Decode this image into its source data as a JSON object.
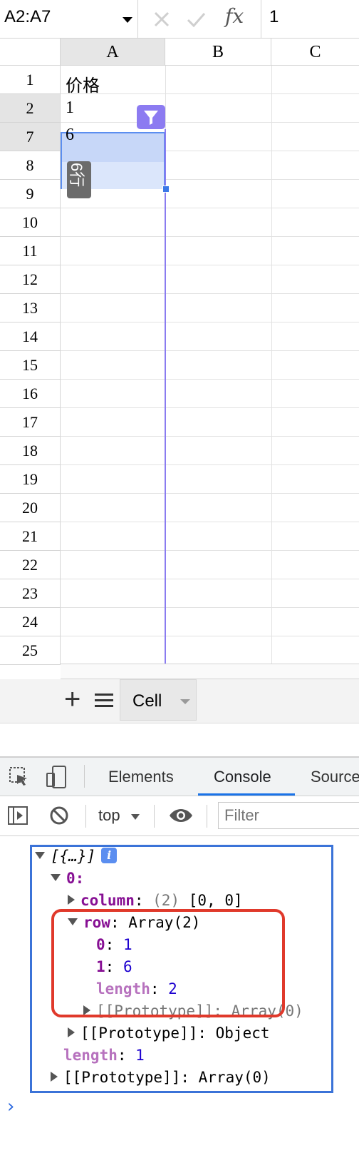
{
  "formula_bar": {
    "name_box": "A2:A7",
    "cancel_icon": "cancel-icon",
    "confirm_icon": "confirm-icon",
    "fx_label": "fx",
    "value": "1"
  },
  "grid": {
    "columns": [
      "A",
      "B",
      "C"
    ],
    "rows": [
      "1",
      "2",
      "7",
      "8",
      "9",
      "10",
      "11",
      "12",
      "13",
      "14",
      "15",
      "16",
      "17",
      "18",
      "19",
      "20",
      "21",
      "22",
      "23",
      "24",
      "25"
    ],
    "selected_rows": [
      "2",
      "7"
    ],
    "cells": {
      "A1": "价格",
      "A2": "1",
      "A7": "6"
    },
    "tooltip": "6行",
    "colors": {
      "selection": "#c7d7f8",
      "selection_border": "#5b8ef0",
      "filter": "#8c7bf1"
    }
  },
  "sheet_bar": {
    "add_icon": "plus-icon",
    "list_icon": "menu-icon",
    "tab_label": "Cell"
  },
  "devtools": {
    "tabs": [
      "Elements",
      "Console",
      "Sources"
    ],
    "active_tab": "Console",
    "context": "top",
    "filter_placeholder": "Filter",
    "console": {
      "root": "[{…}]",
      "info_badge": "i",
      "item0": "0:",
      "column_key": "column",
      "column_count": "(2)",
      "column_value": "[0, 0]",
      "row_key": "row",
      "row_type": "Array(2)",
      "row_0_key": "0",
      "row_0_val": "1",
      "row_1_key": "1",
      "row_1_val": "6",
      "length_key": "length",
      "row_length_val": "2",
      "proto_array": "[[Prototype]]: Array(0)",
      "proto_object": "[[Prototype]]: Object",
      "outer_length_val": "1",
      "outer_proto": "[[Prototype]]: Array(0)"
    },
    "prompt": "›"
  }
}
